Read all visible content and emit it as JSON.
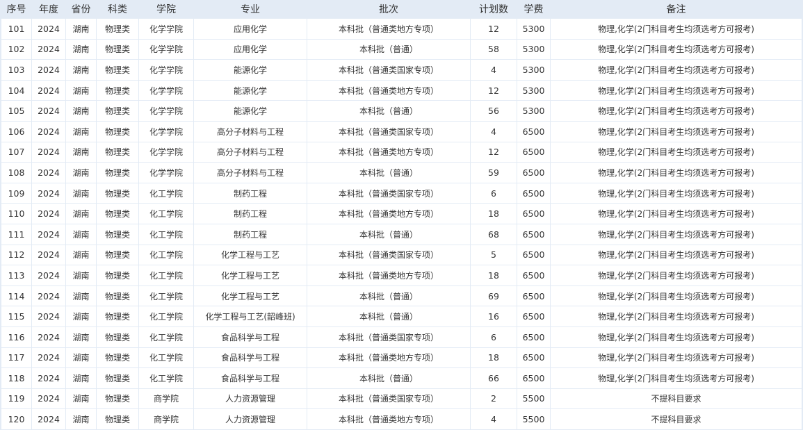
{
  "table": {
    "headers": [
      "序号",
      "年度",
      "省份",
      "科类",
      "学院",
      "专业",
      "批次",
      "计划数",
      "学费",
      "备注"
    ],
    "rows": [
      [
        "101",
        "2024",
        "湖南",
        "物理类",
        "化学学院",
        "应用化学",
        "本科批（普通类地方专项）",
        "12",
        "5300",
        "物理,化学(2门科目考生均须选考方可报考)"
      ],
      [
        "102",
        "2024",
        "湖南",
        "物理类",
        "化学学院",
        "应用化学",
        "本科批（普通）",
        "58",
        "5300",
        "物理,化学(2门科目考生均须选考方可报考)"
      ],
      [
        "103",
        "2024",
        "湖南",
        "物理类",
        "化学学院",
        "能源化学",
        "本科批（普通类国家专项）",
        "4",
        "5300",
        "物理,化学(2门科目考生均须选考方可报考)"
      ],
      [
        "104",
        "2024",
        "湖南",
        "物理类",
        "化学学院",
        "能源化学",
        "本科批（普通类地方专项）",
        "12",
        "5300",
        "物理,化学(2门科目考生均须选考方可报考)"
      ],
      [
        "105",
        "2024",
        "湖南",
        "物理类",
        "化学学院",
        "能源化学",
        "本科批（普通）",
        "56",
        "5300",
        "物理,化学(2门科目考生均须选考方可报考)"
      ],
      [
        "106",
        "2024",
        "湖南",
        "物理类",
        "化学学院",
        "高分子材料与工程",
        "本科批（普通类国家专项）",
        "4",
        "6500",
        "物理,化学(2门科目考生均须选考方可报考)"
      ],
      [
        "107",
        "2024",
        "湖南",
        "物理类",
        "化学学院",
        "高分子材料与工程",
        "本科批（普通类地方专项）",
        "12",
        "6500",
        "物理,化学(2门科目考生均须选考方可报考)"
      ],
      [
        "108",
        "2024",
        "湖南",
        "物理类",
        "化学学院",
        "高分子材料与工程",
        "本科批（普通）",
        "59",
        "6500",
        "物理,化学(2门科目考生均须选考方可报考)"
      ],
      [
        "109",
        "2024",
        "湖南",
        "物理类",
        "化工学院",
        "制药工程",
        "本科批（普通类国家专项）",
        "6",
        "6500",
        "物理,化学(2门科目考生均须选考方可报考)"
      ],
      [
        "110",
        "2024",
        "湖南",
        "物理类",
        "化工学院",
        "制药工程",
        "本科批（普通类地方专项）",
        "18",
        "6500",
        "物理,化学(2门科目考生均须选考方可报考)"
      ],
      [
        "111",
        "2024",
        "湖南",
        "物理类",
        "化工学院",
        "制药工程",
        "本科批（普通）",
        "68",
        "6500",
        "物理,化学(2门科目考生均须选考方可报考)"
      ],
      [
        "112",
        "2024",
        "湖南",
        "物理类",
        "化工学院",
        "化学工程与工艺",
        "本科批（普通类国家专项）",
        "5",
        "6500",
        "物理,化学(2门科目考生均须选考方可报考)"
      ],
      [
        "113",
        "2024",
        "湖南",
        "物理类",
        "化工学院",
        "化学工程与工艺",
        "本科批（普通类地方专项）",
        "18",
        "6500",
        "物理,化学(2门科目考生均须选考方可报考)"
      ],
      [
        "114",
        "2024",
        "湖南",
        "物理类",
        "化工学院",
        "化学工程与工艺",
        "本科批（普通）",
        "69",
        "6500",
        "物理,化学(2门科目考生均须选考方可报考)"
      ],
      [
        "115",
        "2024",
        "湖南",
        "物理类",
        "化工学院",
        "化学工程与工艺(韶峰班)",
        "本科批（普通）",
        "16",
        "6500",
        "物理,化学(2门科目考生均须选考方可报考)"
      ],
      [
        "116",
        "2024",
        "湖南",
        "物理类",
        "化工学院",
        "食品科学与工程",
        "本科批（普通类国家专项）",
        "6",
        "6500",
        "物理,化学(2门科目考生均须选考方可报考)"
      ],
      [
        "117",
        "2024",
        "湖南",
        "物理类",
        "化工学院",
        "食品科学与工程",
        "本科批（普通类地方专项）",
        "18",
        "6500",
        "物理,化学(2门科目考生均须选考方可报考)"
      ],
      [
        "118",
        "2024",
        "湖南",
        "物理类",
        "化工学院",
        "食品科学与工程",
        "本科批（普通）",
        "66",
        "6500",
        "物理,化学(2门科目考生均须选考方可报考)"
      ],
      [
        "119",
        "2024",
        "湖南",
        "物理类",
        "商学院",
        "人力资源管理",
        "本科批（普通类国家专项）",
        "2",
        "5500",
        "不提科目要求"
      ],
      [
        "120",
        "2024",
        "湖南",
        "物理类",
        "商学院",
        "人力资源管理",
        "本科批（普通类地方专项）",
        "4",
        "5500",
        "不提科目要求"
      ]
    ]
  },
  "colors": {
    "header_bg": "#e3ebf5",
    "row_bg": "#ffffff",
    "border": "#e3ebf5",
    "text": "#333333"
  }
}
